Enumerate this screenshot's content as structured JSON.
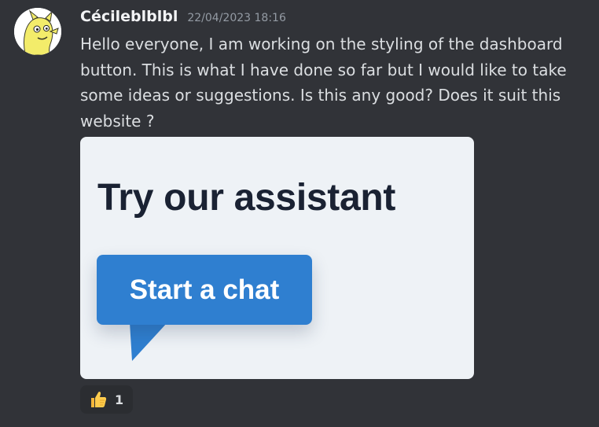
{
  "message": {
    "author": "Cécileblblbl",
    "timestamp": "22/04/2023 18:16",
    "text": "Hello everyone, I am working on the styling of the dashboard button. This is what I have done so far but I would like to take some ideas or suggestions. Is this any good? Does it suit this website ?"
  },
  "attachment": {
    "title": "Try our assistant",
    "button_label": "Start a chat",
    "button_color": "#2f7fd0",
    "background_color": "#eef2f6"
  },
  "reaction": {
    "emoji_icon": "thumbs-up-icon",
    "count": "1"
  }
}
